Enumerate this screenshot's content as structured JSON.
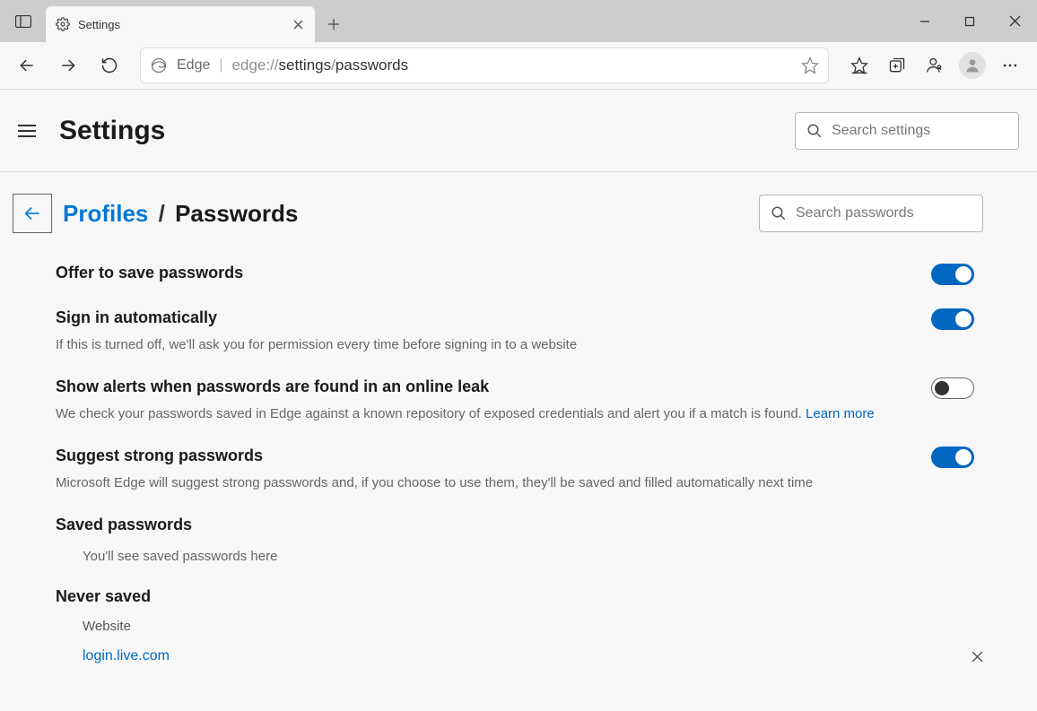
{
  "tab": {
    "title": "Settings"
  },
  "address": {
    "identity": "Edge",
    "url_prefix": "edge://",
    "url_bold1": "settings",
    "url_mid": "/",
    "url_bold2": "passwords"
  },
  "page": {
    "title": "Settings",
    "search_placeholder": "Search settings"
  },
  "breadcrumb": {
    "link": "Profiles",
    "sep": "/",
    "current": "Passwords",
    "search_placeholder": "Search passwords"
  },
  "settings": {
    "offer_save": {
      "title": "Offer to save passwords",
      "on": true
    },
    "autosign": {
      "title": "Sign in automatically",
      "desc": "If this is turned off, we'll ask you for permission every time before signing in to a website",
      "on": true
    },
    "leak": {
      "title": "Show alerts when passwords are found in an online leak",
      "desc": "We check your passwords saved in Edge against a known repository of exposed credentials and alert you if a match is found. ",
      "learn": "Learn more",
      "on": false
    },
    "suggest": {
      "title": "Suggest strong passwords",
      "desc": "Microsoft Edge will suggest strong passwords and, if you choose to use them, they'll be saved and filled automatically next time",
      "on": true
    }
  },
  "saved": {
    "title": "Saved passwords",
    "hint": "You'll see saved passwords here"
  },
  "never": {
    "title": "Never saved",
    "column": "Website",
    "rows": [
      {
        "site": "login.live.com"
      }
    ]
  }
}
